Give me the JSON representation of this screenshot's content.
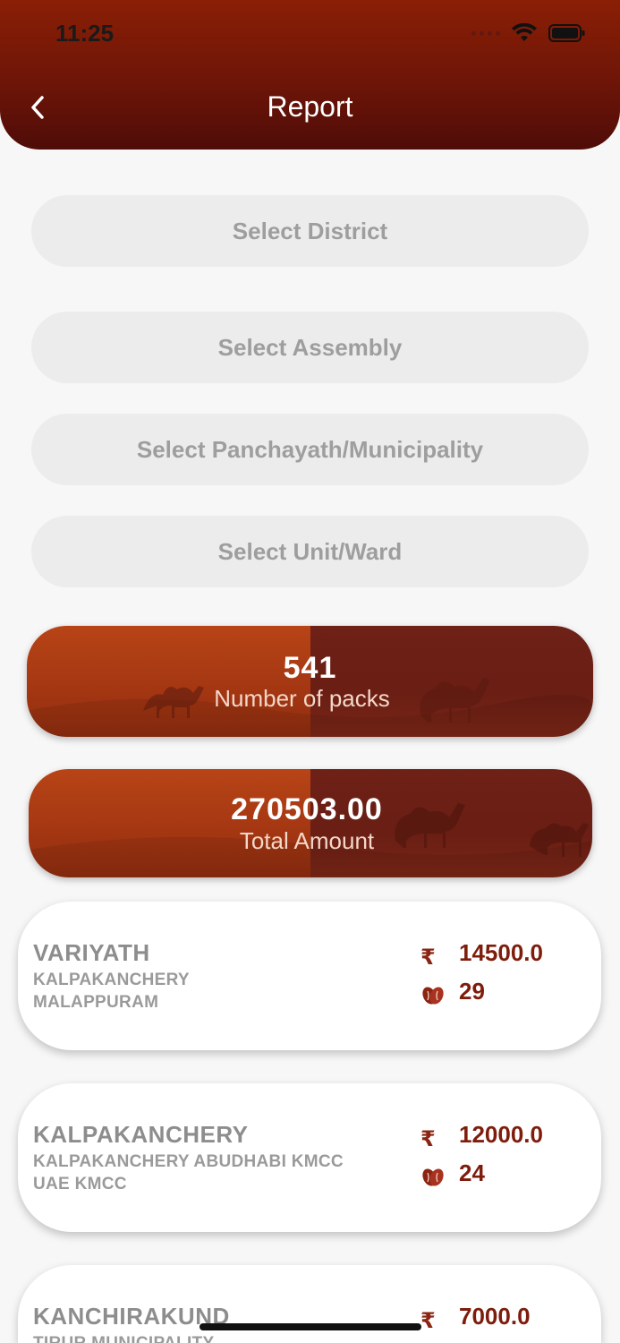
{
  "status_bar": {
    "time": "11:25"
  },
  "header": {
    "title": "Report"
  },
  "filters": {
    "district": "Select District",
    "assembly": "Select Assembly",
    "panchayath": "Select Panchayath/Municipality",
    "unit": "Select Unit/Ward"
  },
  "stats": {
    "packs": {
      "value": "541",
      "label": "Number of packs"
    },
    "amount": {
      "value": "270503.00",
      "label": "Total Amount"
    }
  },
  "currency_symbol": "₹",
  "records": [
    {
      "name": "VARIYATH",
      "line1": "KALPAKANCHERY",
      "line2": "MALAPPURAM",
      "amount": "14500.0",
      "packs": "29"
    },
    {
      "name": "KALPAKANCHERY",
      "line1": "KALPAKANCHERY ABUDHABI KMCC",
      "line2": "UAE KMCC",
      "amount": "12000.0",
      "packs": "24"
    },
    {
      "name": "KANCHIRAKUND",
      "line1": "TIRUR MUNICIPALITY",
      "line2": "",
      "amount": "7000.0",
      "packs": ""
    }
  ],
  "colors": {
    "header": "#7a1a06",
    "accent": "#7e1d0c",
    "select_bg": "#ececec"
  }
}
